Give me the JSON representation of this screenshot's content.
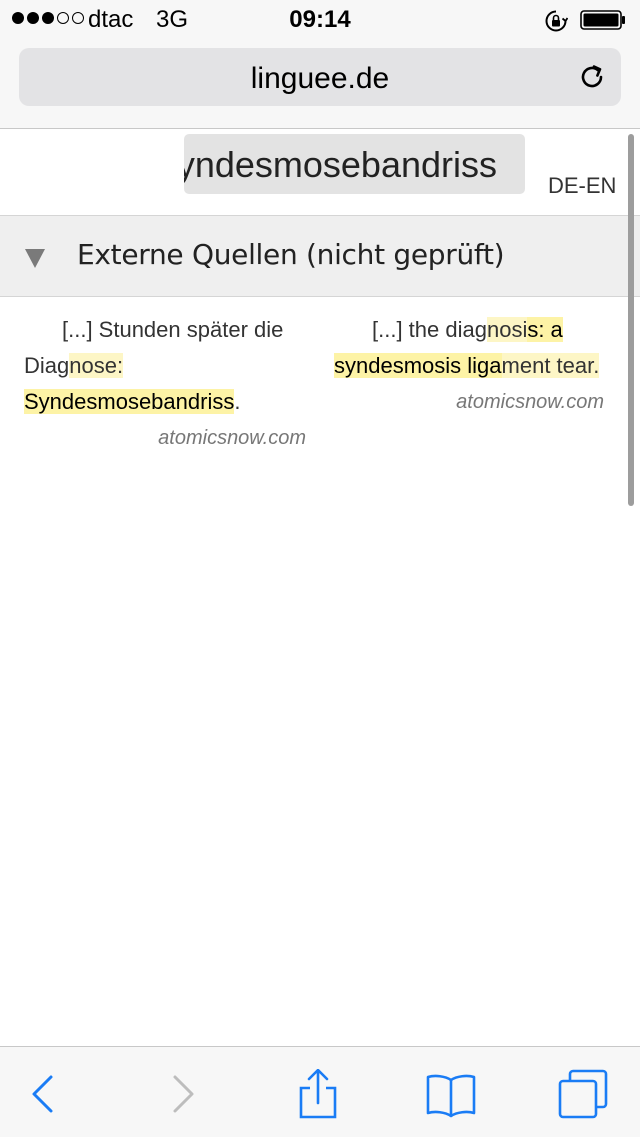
{
  "status_bar": {
    "signal_filled": 3,
    "signal_total": 5,
    "carrier": "dtac",
    "network": "3G",
    "time": "09:14",
    "icons": [
      "rotation-lock-icon",
      "battery-icon"
    ]
  },
  "browser": {
    "url": "linguee.de",
    "icons": [
      "reload-icon",
      "back-icon",
      "forward-icon",
      "share-icon",
      "bookmarks-icon",
      "tabs-icon"
    ],
    "accent_color": "#1a7cf5",
    "disabled_color": "#bdbdbd"
  },
  "search": {
    "query": "Syndesmosebandriss",
    "language_pair": "DE-EN"
  },
  "section": {
    "title": "Externe Quellen (nicht geprüft)"
  },
  "examples": [
    {
      "de": {
        "part1": "[...] Stunden später die Diag",
        "part2": "nose:",
        "part3": "Syndesmosebandriss",
        "part4": "."
      },
      "en": {
        "part1": "[...] the diag",
        "part2": "nosi",
        "part3": "s: a syndesmosis liga",
        "part4": "ment tear."
      },
      "source_de": "atomicsnow.com",
      "source_en": "atomicsnow.com"
    }
  ]
}
